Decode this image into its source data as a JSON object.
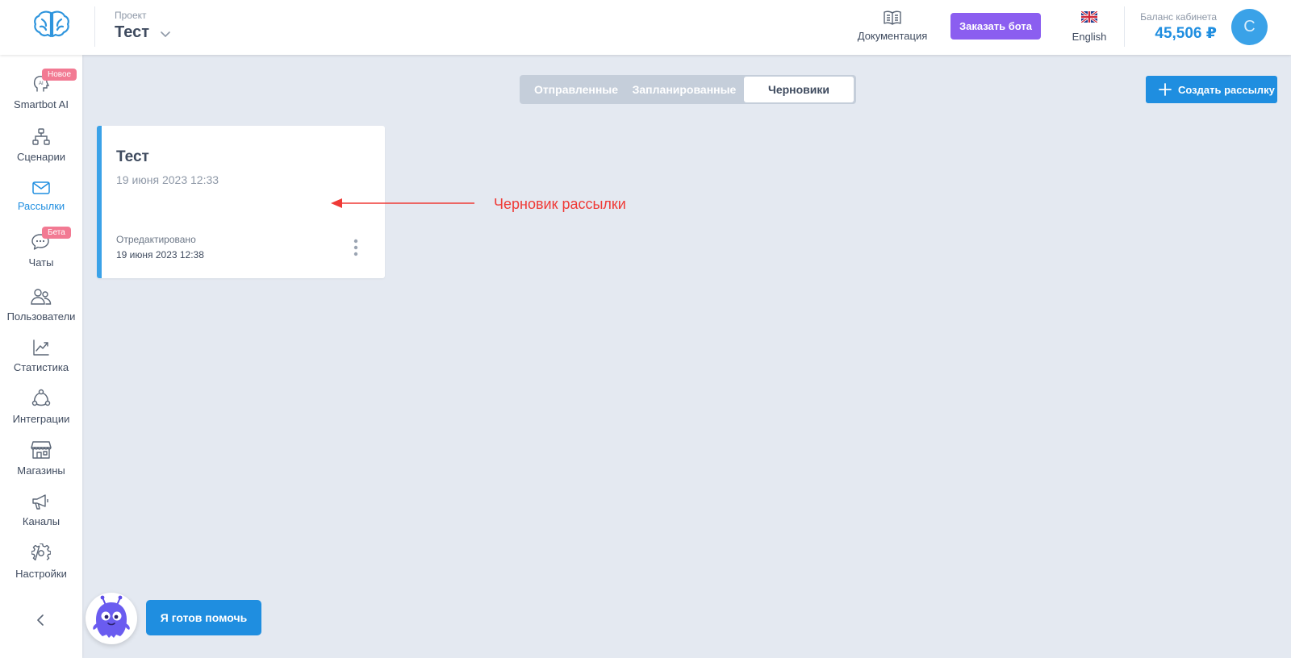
{
  "header": {
    "project_label": "Проект",
    "project_name": "Тест",
    "docs_label": "Документация",
    "order_bot_label": "Заказать бота",
    "language_label": "English",
    "balance_label": "Баланс кабинета",
    "balance_value": "45,506 ₽",
    "avatar_initial": "С"
  },
  "sidebar": {
    "items": [
      {
        "label": "Smartbot AI",
        "icon": "ai-head-icon",
        "badge": "Новое"
      },
      {
        "label": "Сценарии",
        "icon": "flowchart-icon"
      },
      {
        "label": "Рассылки",
        "icon": "mail-icon",
        "active": true
      },
      {
        "label": "Чаты",
        "icon": "chat-bubbles-icon",
        "badge": "Бета"
      },
      {
        "label": "Пользователи",
        "icon": "users-icon"
      },
      {
        "label": "Статистика",
        "icon": "chart-line-icon"
      },
      {
        "label": "Интеграции",
        "icon": "integrations-icon"
      },
      {
        "label": "Магазины",
        "icon": "store-icon"
      },
      {
        "label": "Каналы",
        "icon": "megaphone-icon"
      },
      {
        "label": "Настройки",
        "icon": "gear-icon"
      }
    ]
  },
  "tabs": {
    "items": [
      {
        "label": "Отправленные"
      },
      {
        "label": "Запланированные"
      },
      {
        "label": "Черновики",
        "active": true
      }
    ]
  },
  "create_button_label": "Создать рассылку",
  "draft_card": {
    "title": "Тест",
    "date": "19 июня 2023 12:33",
    "edited_label": "Отредактировано",
    "edited_date": "19 июня 2023 12:38"
  },
  "annotation": {
    "text": "Черновик рассылки",
    "color": "#ef3a36"
  },
  "helper": {
    "button_label": "Я готов помочь"
  },
  "colors": {
    "accent": "#1f8ee0",
    "order_button": "#8b5ef0",
    "badge": "#f27a93",
    "background": "#e4e9f1"
  }
}
